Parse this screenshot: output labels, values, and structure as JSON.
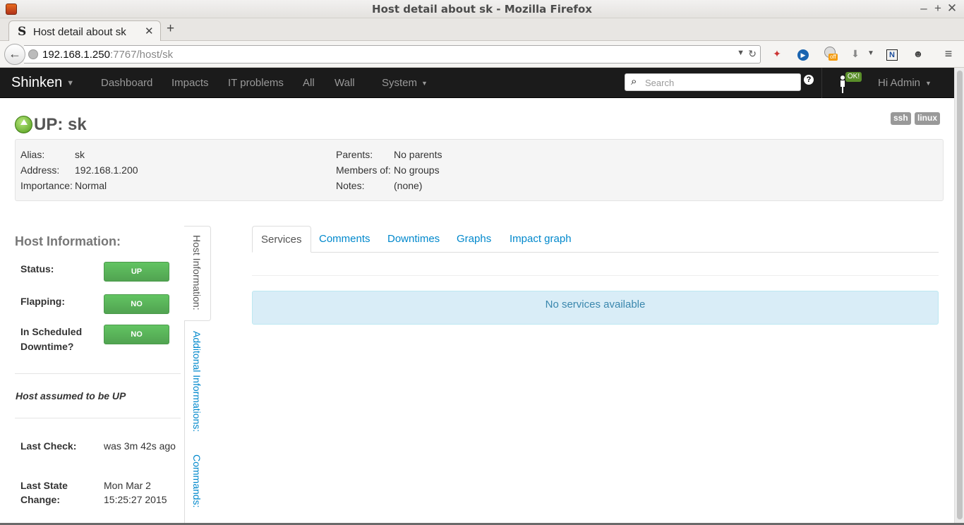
{
  "window": {
    "title": "Host detail about sk - Mozilla Firefox"
  },
  "browser": {
    "tab_title": "Host detail about sk",
    "tab_favicon": "S",
    "url_host": "192.168.1.250",
    "url_rest": ":7767/host/sk",
    "toolbar_icons": [
      "flashgot-icon",
      "video-download-icon",
      "adblock-icon",
      "download-icon",
      "noscript-icon",
      "chat-icon",
      "menu-icon"
    ]
  },
  "appnav": {
    "brand": "Shinken",
    "items": [
      "Dashboard",
      "Impacts",
      "IT problems",
      "All",
      "Wall",
      "System"
    ],
    "search_placeholder": "Search",
    "help": "?",
    "ok_badge": "OK!",
    "user": "Hi Admin"
  },
  "host": {
    "title": "UP: sk",
    "tags": [
      "ssh",
      "linux"
    ],
    "alias_label": "Alias:",
    "alias": "sk",
    "address_label": "Address:",
    "address": "192.168.1.200",
    "importance_label": "Importance:",
    "importance": "Normal",
    "parents_label": "Parents:",
    "parents": "No parents",
    "members_label": "Members of:",
    "members": "No groups",
    "notes_label": "Notes:",
    "notes": "(none)"
  },
  "left": {
    "title": "Host Information:",
    "status_label": "Status:",
    "status": "UP",
    "flapping_label": "Flapping:",
    "flapping": "NO",
    "downtime_label_1": "In Scheduled",
    "downtime_label_2": "Downtime?",
    "downtime": "NO",
    "assumed": "Host assumed to be UP",
    "last_check_label": "Last Check:",
    "last_check": "was 3m 42s ago",
    "last_state_label_1": "Last State",
    "last_state_label_2": "Change:",
    "last_state": "Mon Mar 2 15:25:27 2015"
  },
  "vtabs": [
    "Host Information:",
    "Additonal Informations:",
    "Commands:"
  ],
  "tabs": [
    "Services",
    "Comments",
    "Downtimes",
    "Graphs",
    "Impact graph"
  ],
  "services_message": "No services available",
  "colors": {
    "navbar": "#1b1b1b",
    "link": "#0088cc",
    "success": "#5bb75b",
    "info_bg": "#d9edf7"
  }
}
